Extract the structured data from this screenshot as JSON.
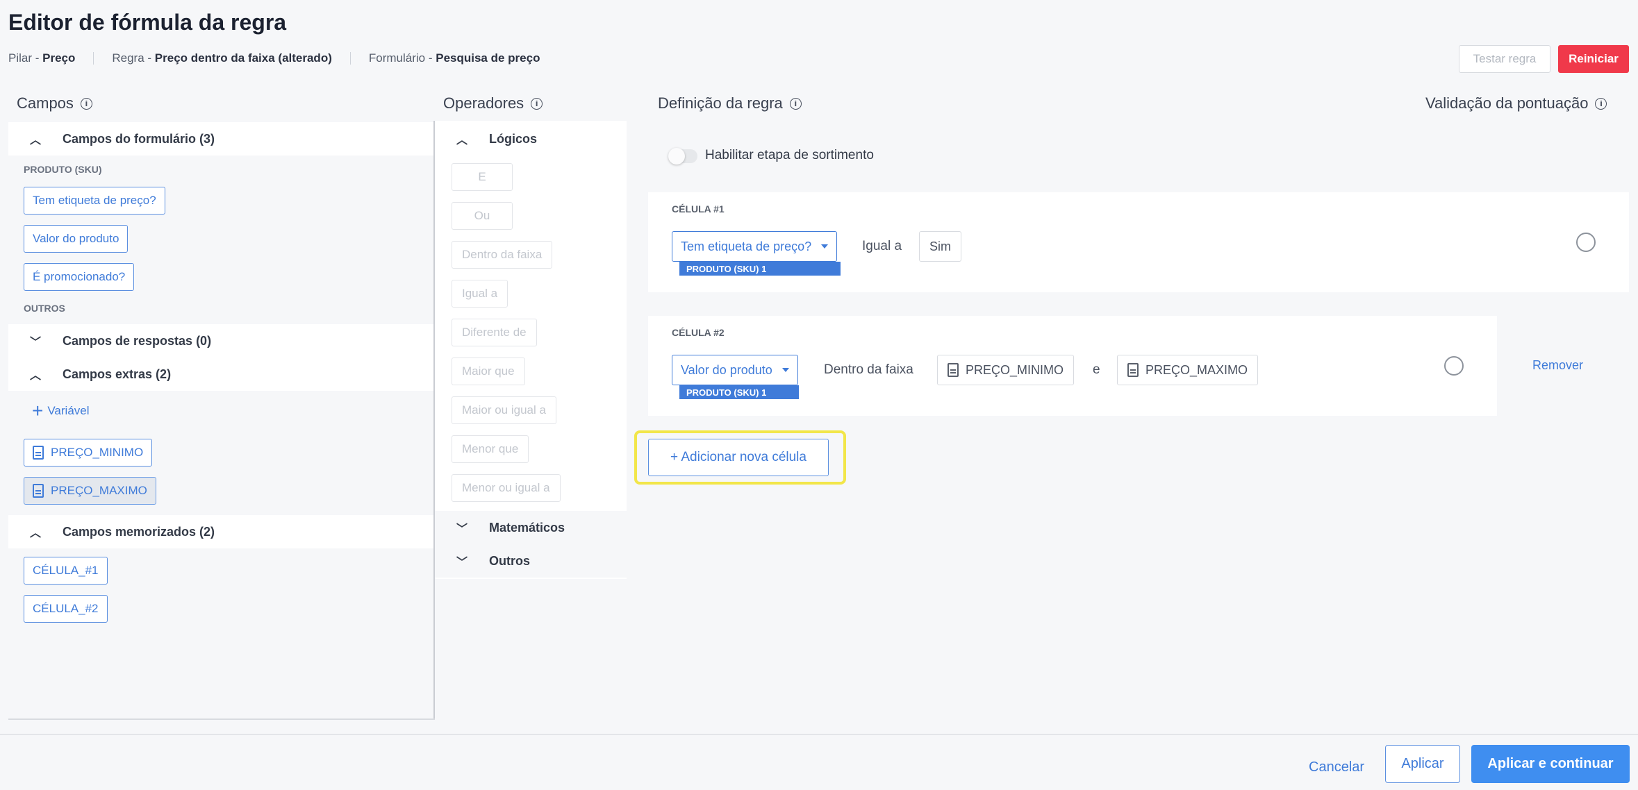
{
  "header": {
    "title": "Editor de fórmula da regra",
    "breadcrumb": [
      {
        "label": "Pilar - ",
        "value": "Preço"
      },
      {
        "label": "Regra - ",
        "value": "Preço dentro da faixa (alterado)"
      },
      {
        "label": "Formulário - ",
        "value": "Pesquisa de preço"
      }
    ],
    "test_button": "Testar regra",
    "restart_button": "Reiniciar"
  },
  "campos": {
    "title": "Campos",
    "form_fields_group": "Campos do formulário (3)",
    "product_label": "PRODUTO (SKU)",
    "product_fields": [
      "Tem etiqueta de preço?",
      "Valor do produto",
      "É promocionado?"
    ],
    "others_label": "OUTROS",
    "response_fields_group": "Campos de respostas (0)",
    "extra_fields_group": "Campos extras (2)",
    "add_variable": "Variável",
    "extra_fields": [
      "PREÇO_MINIMO",
      "PREÇO_MAXIMO"
    ],
    "memo_fields_group": "Campos memorizados (2)",
    "memo_fields": [
      "CÉLULA_#1",
      "CÉLULA_#2"
    ]
  },
  "operadores": {
    "title": "Operadores",
    "logical_group": "Lógicos",
    "logical_ops": [
      "E",
      "Ou",
      "Dentro da faixa",
      "Igual a",
      "Diferente de",
      "Maior que",
      "Maior ou igual a",
      "Menor que",
      "Menor ou igual a"
    ],
    "math_group": "Matemáticos",
    "other_group": "Outros"
  },
  "definicao": {
    "title": "Definição da regra",
    "toggle_label": "Habilitar etapa de sortimento",
    "cells": [
      {
        "label": "CÉLULA #1",
        "field": "Tem etiqueta de preço?",
        "field_tag": "PRODUTO (SKU) 1",
        "operator": "Igual a",
        "value": "Sim"
      },
      {
        "label": "CÉLULA #2",
        "field": "Valor do produto",
        "field_tag": "PRODUTO (SKU) 1",
        "operator": "Dentro da faixa",
        "value_min": "PREÇO_MINIMO",
        "conjunction": "e",
        "value_max": "PREÇO_MAXIMO",
        "remove_label": "Remover"
      }
    ],
    "add_cell_button": "+ Adicionar nova célula"
  },
  "validacao": {
    "title": "Validação da pontuação"
  },
  "footer": {
    "cancel": "Cancelar",
    "apply": "Aplicar",
    "apply_continue": "Aplicar e continuar"
  },
  "colors": {
    "accent": "#3f7bd9",
    "primary_button": "#3f8ef0",
    "danger": "#f0394a",
    "highlight": "#f2e64a"
  }
}
